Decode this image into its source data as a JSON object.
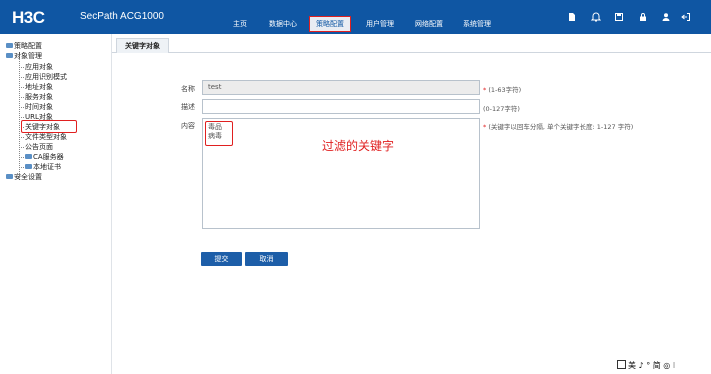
{
  "header": {
    "logo": "H3C",
    "product": "SecPath ACG1000",
    "nav": [
      "主页",
      "数据中心",
      "策略配置",
      "用户管理",
      "网络配置",
      "系统管理"
    ],
    "active_nav": "策略配置",
    "icons": [
      "document-icon",
      "bell-icon",
      "save-icon",
      "lock-icon",
      "user-icon",
      "logout-icon"
    ]
  },
  "sidebar": {
    "items": [
      {
        "label": "策略配置",
        "level": 0
      },
      {
        "label": "对象管理",
        "level": 0
      },
      {
        "label": "应用对象",
        "level": 1
      },
      {
        "label": "应用识别模式",
        "level": 1
      },
      {
        "label": "地址对象",
        "level": 1
      },
      {
        "label": "服务对象",
        "level": 1
      },
      {
        "label": "时间对象",
        "level": 1
      },
      {
        "label": "URL对象",
        "level": 1
      },
      {
        "label": "关键字对象",
        "level": 1,
        "selected": true
      },
      {
        "label": "文件类型对象",
        "level": 1
      },
      {
        "label": "公告页面",
        "level": 1
      },
      {
        "label": "CA服务器",
        "level": 1
      },
      {
        "label": "本地证书",
        "level": 1
      },
      {
        "label": "安全设置",
        "level": 0
      }
    ]
  },
  "tab": {
    "label": "关键字对象"
  },
  "form": {
    "name_label": "名称",
    "name_value": "test",
    "name_hint": "(1-63字符)",
    "desc_label": "描述",
    "desc_value": "",
    "desc_hint": "(0-127字符)",
    "content_label": "内容",
    "content_lines": [
      "毒品",
      "病毒"
    ],
    "content_hint": "(关键字以回车分隔, 单个关键字长度: 1-127 字符)",
    "required_mark": "*"
  },
  "buttons": {
    "submit": "提交",
    "cancel": "取消"
  },
  "annotation": "过滤的关键字",
  "ime_bar": "美 ♪ ° 简 ◎ ⁝",
  "colors": {
    "header_bg": "#0f56a3",
    "highlight_red": "#e02020",
    "button_bg": "#1d5ea8"
  }
}
